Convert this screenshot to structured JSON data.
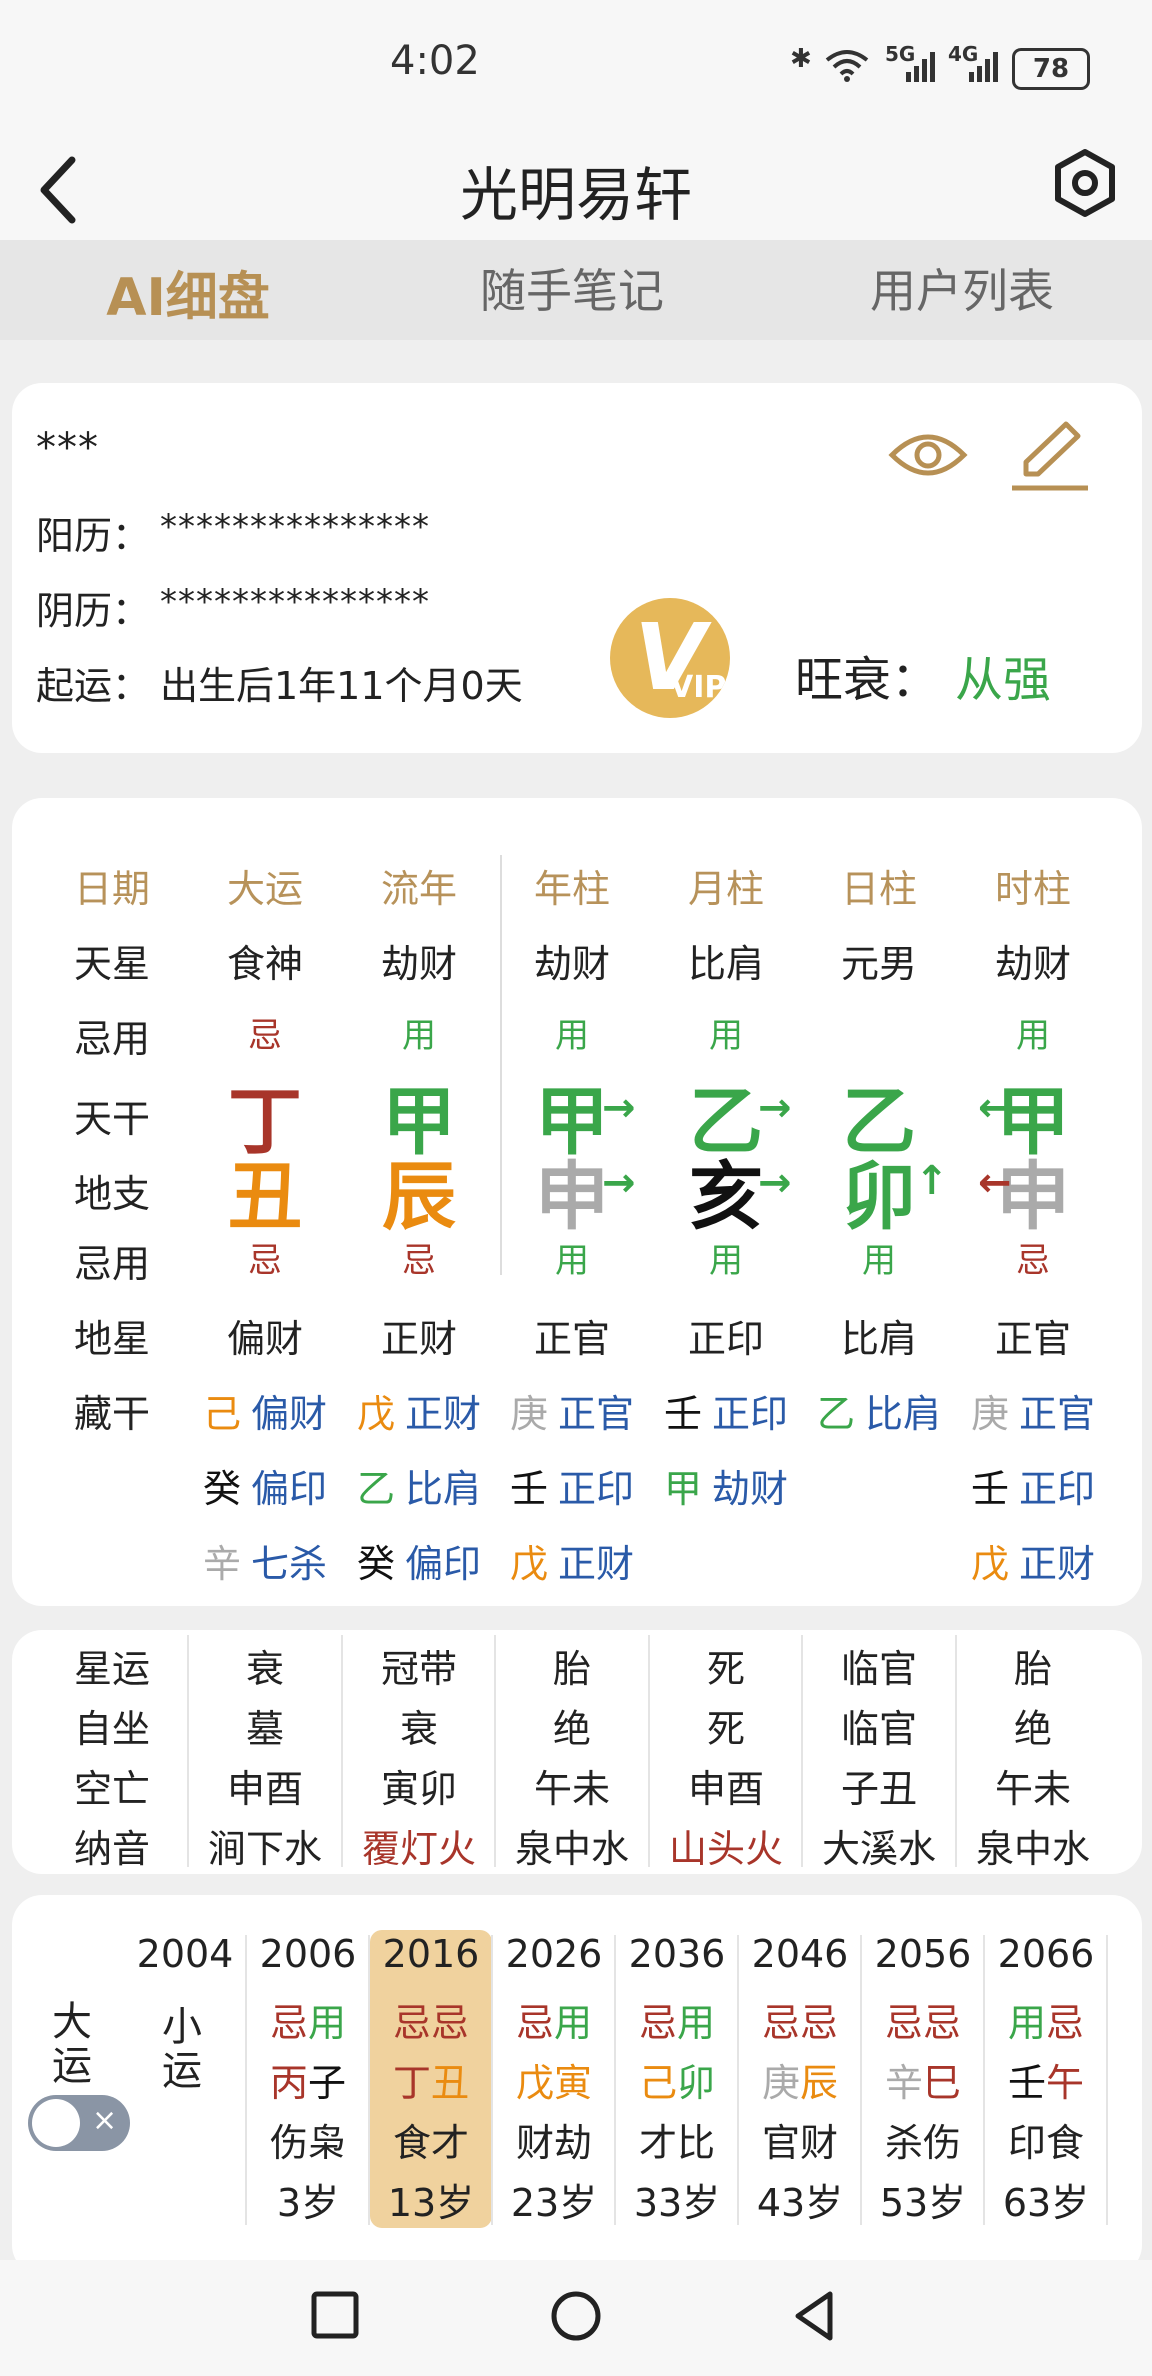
{
  "status_bar": {
    "time": "4:02",
    "battery": "78"
  },
  "header": {
    "title": "光明易轩"
  },
  "tabs": [
    {
      "label": "AI细盘"
    },
    {
      "label": "随手笔记"
    },
    {
      "label": "用户列表"
    }
  ],
  "profile": {
    "name": "***",
    "solar_label": "阳历：",
    "solar_value": "***************",
    "lunar_label": "阴历：",
    "lunar_value": "***************",
    "luck_label": "起运：",
    "luck_value": "出生后1年11个月0天",
    "strength_label": "旺衰：",
    "strength_value": "从强",
    "vip_text": "VIP"
  },
  "chart": {
    "col_headers": [
      "日期",
      "大运",
      "流年",
      "年柱",
      "月柱",
      "日柱",
      "时柱"
    ],
    "row_labels": [
      "天星",
      "忌用",
      "天干",
      "地支",
      "忌用",
      "地星",
      "藏干"
    ],
    "tianxing": [
      "食神",
      "劫财",
      "劫财",
      "比肩",
      "元男",
      "劫财"
    ],
    "jiyong_top": [
      "忌",
      "用",
      "用",
      "用",
      "",
      "用"
    ],
    "tiangan": [
      "丁",
      "甲",
      "甲",
      "乙",
      "乙",
      "甲"
    ],
    "dizhi": [
      "丑",
      "辰",
      "申",
      "亥",
      "卯",
      "申"
    ],
    "jiyong_bottom": [
      "忌",
      "忌",
      "用",
      "用",
      "用",
      "忌"
    ],
    "dixing": [
      "偏财",
      "正财",
      "正官",
      "正印",
      "比肩",
      "正官"
    ],
    "canggan": [
      [
        {
          "c": "己",
          "s": "偏财"
        },
        {
          "c": "癸",
          "s": "偏印"
        },
        {
          "c": "辛",
          "s": "七杀"
        }
      ],
      [
        {
          "c": "戊",
          "s": "正财"
        },
        {
          "c": "乙",
          "s": "比肩"
        },
        {
          "c": "癸",
          "s": "偏印"
        }
      ],
      [
        {
          "c": "庚",
          "s": "正官"
        },
        {
          "c": "壬",
          "s": "正印"
        },
        {
          "c": "戊",
          "s": "正财"
        }
      ],
      [
        {
          "c": "壬",
          "s": "正印"
        },
        {
          "c": "甲",
          "s": "劫财"
        }
      ],
      [
        {
          "c": "乙",
          "s": "比肩"
        }
      ],
      [
        {
          "c": "庚",
          "s": "正官"
        },
        {
          "c": "壬",
          "s": "正印"
        },
        {
          "c": "戊",
          "s": "正财"
        }
      ]
    ]
  },
  "misc": {
    "row_labels": [
      "星运",
      "自坐",
      "空亡",
      "纳音"
    ],
    "xingyun": [
      "衰",
      "冠带",
      "胎",
      "死",
      "临官",
      "胎"
    ],
    "zizuo": [
      "墓",
      "衰",
      "绝",
      "死",
      "临官",
      "绝"
    ],
    "kongwang": [
      "申酉",
      "寅卯",
      "午未",
      "申酉",
      "子丑",
      "午未"
    ],
    "nayin": [
      "涧下水",
      "覆灯火",
      "泉中水",
      "山头火",
      "大溪水",
      "泉中水"
    ]
  },
  "dayun": {
    "label_dayun": "大运",
    "label_xiaoyun": "小运",
    "toggle_x": "×",
    "years": [
      "2004",
      "2006",
      "2016",
      "2026",
      "2036",
      "2046",
      "2056",
      "2066"
    ],
    "jiyong": [
      [
        "忌",
        "用"
      ],
      [
        "忌",
        "忌"
      ],
      [
        "忌",
        "用"
      ],
      [
        "忌",
        "用"
      ],
      [
        "忌",
        "忌"
      ],
      [
        "忌",
        "忌"
      ],
      [
        "用",
        "忌"
      ]
    ],
    "ganzhi": [
      [
        "丙",
        "子"
      ],
      [
        "丁",
        "丑"
      ],
      [
        "戊",
        "寅"
      ],
      [
        "己",
        "卯"
      ],
      [
        "庚",
        "辰"
      ],
      [
        "辛",
        "巳"
      ],
      [
        "壬",
        "午"
      ]
    ],
    "shishen": [
      "伤枭",
      "食才",
      "财劫",
      "才比",
      "官财",
      "杀伤",
      "印食"
    ],
    "ages": [
      "3岁",
      "13岁",
      "23岁",
      "33岁",
      "43岁",
      "53岁",
      "63岁"
    ]
  },
  "colors": {
    "accent": "#b79054",
    "ji": "#a8352a",
    "yong": "#3aa64a",
    "orange": "#ea8b10",
    "blue": "#2a5aa8",
    "highlight": "#f0d29e"
  }
}
